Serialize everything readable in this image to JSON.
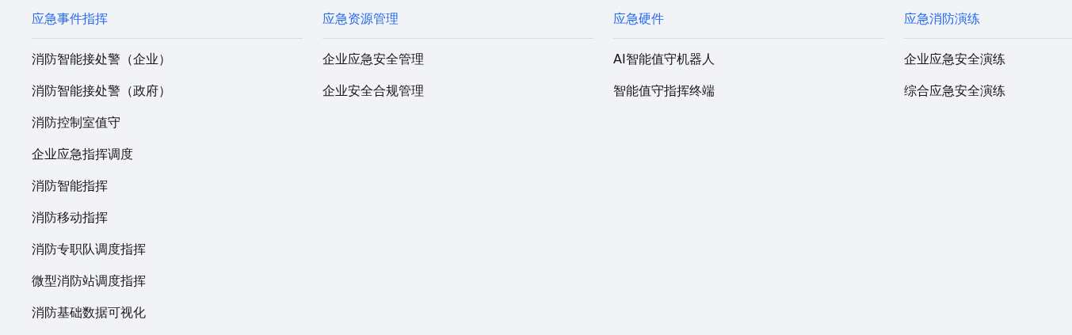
{
  "columns": [
    {
      "heading": "应急事件指挥",
      "items": [
        "消防智能接处警（企业）",
        "消防智能接处警（政府）",
        "消防控制室值守",
        "企业应急指挥调度",
        "消防智能指挥",
        "消防移动指挥",
        "消防专职队调度指挥",
        "微型消防站调度指挥",
        "消防基础数据可视化"
      ]
    },
    {
      "heading": "应急资源管理",
      "items": [
        "企业应急安全管理",
        "企业安全合规管理"
      ]
    },
    {
      "heading": "应急硬件",
      "items": [
        "AI智能值守机器人",
        "智能值守指挥终端"
      ]
    },
    {
      "heading": "应急消防演练",
      "items": [
        "企业应急安全演练",
        "综合应急安全演练"
      ]
    }
  ]
}
